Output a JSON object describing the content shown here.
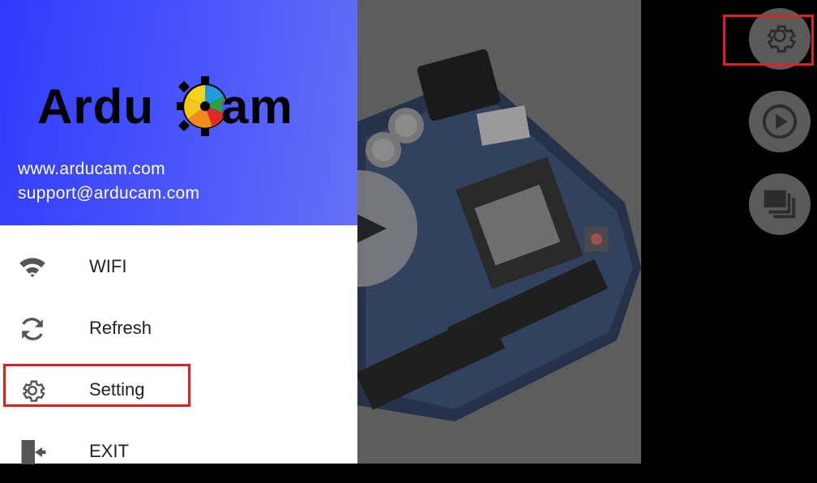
{
  "drawer": {
    "logo": {
      "text_left": "Ardu",
      "text_right": "am"
    },
    "website": "www.arducam.com",
    "email": "support@arducam.com",
    "menu": [
      {
        "label": "WIFI",
        "icon": "wifi-icon"
      },
      {
        "label": "Refresh",
        "icon": "refresh-icon"
      },
      {
        "label": "Setting",
        "icon": "gear-icon"
      },
      {
        "label": "EXIT",
        "icon": "exit-icon"
      }
    ]
  },
  "right_toolbar": {
    "buttons": [
      {
        "icon": "gear-icon"
      },
      {
        "icon": "play-circle-icon"
      },
      {
        "icon": "gallery-icon"
      }
    ]
  },
  "colors": {
    "header_gradient_start": "#2f3bfb",
    "header_gradient_end": "#6571f5",
    "highlight": "#e02020",
    "fab": "#5a5a5a"
  }
}
